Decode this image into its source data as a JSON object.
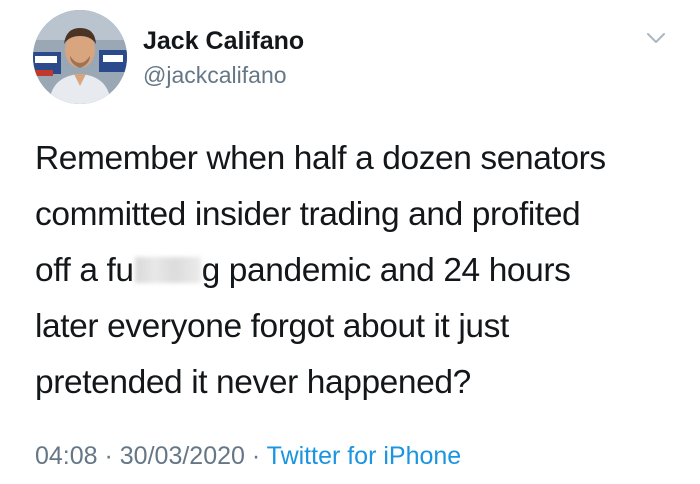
{
  "author": {
    "name": "Jack Califano",
    "handle": "@jackcalifano"
  },
  "tweet": {
    "lines": [
      "Remember when half a dozen senators",
      "committed insider trading and profited",
      "off a fu",
      "g pandemic and 24 hours",
      "later everyone forgot about it just",
      "pretended it never happened?"
    ]
  },
  "meta": {
    "time": "04:08",
    "separator": " · ",
    "date": "30/03/2020",
    "source": "Twitter for iPhone"
  },
  "icons": {
    "avatar": "profile-photo",
    "menu": "chevron-down-icon"
  },
  "colors": {
    "text": "#14171a",
    "muted": "#657786",
    "link": "#1b95e0"
  }
}
